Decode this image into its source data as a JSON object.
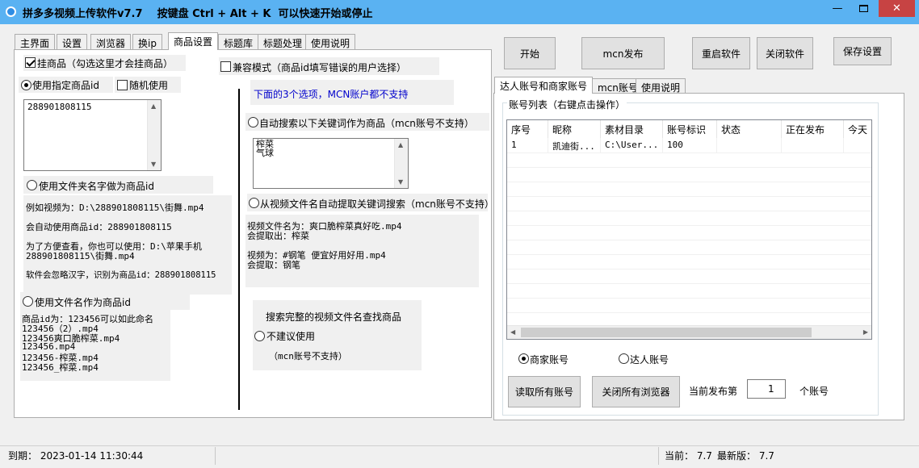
{
  "window": {
    "title": "拼多多视频上传软件v7.7    按键盘 Ctrl + Alt + K  可以快速开始或停止",
    "minimize": "—",
    "close": "✕"
  },
  "tabs": [
    "主界面",
    "设置",
    "浏览器",
    "换ip",
    "商品设置",
    "标题库",
    "标题处理",
    "使用说明"
  ],
  "left": {
    "hang_goods": "挂商品（勾选这里才会挂商品）",
    "use_specified_id": "使用指定商品id",
    "random_use": "随机使用",
    "goods_id_value": "288901808115",
    "use_folder_name": "使用文件夹名字做为商品id",
    "example_1": "例如视频为：D:\\288901808115\\街舞.mp4",
    "example_2": "会自动使用商品id：288901808115",
    "example_3a": "为了方便查看，你也可以使用：D:\\苹果手机",
    "example_3b": "288901808115\\街舞.mp4",
    "example_4": "软件会忽略汉字，识别为商品id：288901808115",
    "use_file_name": "使用文件名作为商品id",
    "naming_lines": [
      "商品id为：123456可以如此命名",
      "123456（2）.mp4",
      "123456爽口脆榨菜.mp4",
      "123456.mp4",
      "123456-榨菜.mp4",
      "123456_榨菜.mp4"
    ]
  },
  "middle": {
    "compat_mode": "兼容模式（商品id填写错误的用户选择）",
    "notice": "下面的3个选项，MCN账户都不支持",
    "auto_search": "自动搜索以下关键词作为商品（mcn账号不支持）",
    "keywords": [
      "榨菜",
      "气球"
    ],
    "extract_from_name": "从视频文件名自动提取关键词搜索（mcn账号不支持）",
    "extract_lines": [
      "视频文件名为：爽口脆榨菜真好吃.mp4",
      "会提取出：榨菜",
      "",
      "视频为：#钢笔 便宜好用好用.mp4",
      "会提取：钢笔"
    ],
    "full_search_title": "搜索完整的视频文件名查找商品",
    "not_recommended": "不建议使用",
    "mcn_not_supported": "（mcn账号不支持）"
  },
  "right": {
    "buttons": {
      "start": "开始",
      "mcn_publish": "mcn发布",
      "restart": "重启软件",
      "close_soft": "关闭软件",
      "save": "保存设置"
    },
    "subtabs": [
      "达人账号和商家账号",
      "mcn账号",
      "使用说明"
    ],
    "group_title": "账号列表（右键点击操作）",
    "columns": [
      "序号",
      "昵称",
      "素材目录",
      "账号标识",
      "状态",
      "正在发布",
      "今天"
    ],
    "rows": [
      {
        "index": "1",
        "nickname": "凯迪街...",
        "folder": "C:\\User...",
        "account_id": "100",
        "status": "",
        "publishing": "",
        "today": ""
      }
    ],
    "merchant_account": "商家账号",
    "talent_account": "达人账号",
    "read_accounts": "读取所有账号",
    "close_browsers": "关闭所有浏览器",
    "current_publish_label": "当前发布第",
    "current_publish_value": "1",
    "accounts_suffix": "个账号"
  },
  "status": {
    "expiry": "到期：  2023-01-14 11:30:44",
    "current": "当前：  7.7",
    "latest": "最新版：  7.7"
  },
  "colors": {
    "titlebar": "#5ab2f2",
    "notice_text": "#0000cc",
    "close_button": "#c74343"
  }
}
